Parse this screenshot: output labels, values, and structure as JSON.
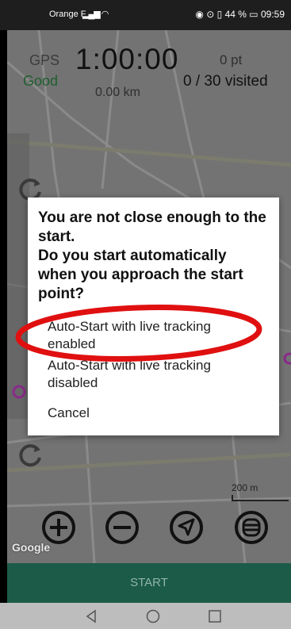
{
  "status_bar": {
    "carrier": "Orange F",
    "battery_percent": "44 %",
    "time": "09:59"
  },
  "hud": {
    "gps_label": "GPS",
    "gps_status": "Good",
    "timer": "1:00:00",
    "distance": "0.00 km",
    "points": "0 pt",
    "visited": "0 / 30 visited"
  },
  "dialog": {
    "message": "You are not close enough to the start.\nDo you start automatically when you approach the start point?",
    "options": [
      "Auto-Start with live tracking enabled",
      "Auto-Start with live tracking disabled",
      "Cancel"
    ]
  },
  "map": {
    "scale_label": "200 m",
    "attribution": "Google"
  },
  "toolbar": {
    "buttons": [
      "zoom-in",
      "zoom-out",
      "my-location",
      "layers"
    ]
  },
  "start_button": {
    "label": "START"
  },
  "colors": {
    "start_bar": "#1d5b49",
    "gps_good": "#1f5f2f",
    "highlight_ellipse": "#e01010"
  }
}
